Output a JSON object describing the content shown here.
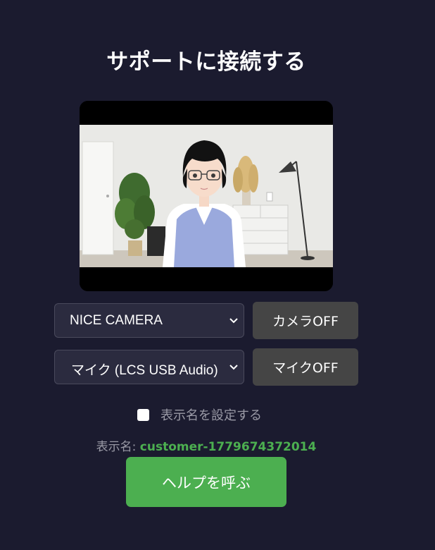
{
  "title": "サポートに接続する",
  "camera": {
    "selected": "NICE CAMERA",
    "toggle_label": "カメラOFF"
  },
  "mic": {
    "selected": "マイク (LCS USB Audio)",
    "toggle_label": "マイクOFF"
  },
  "set_display_name": {
    "label": "表示名を設定する",
    "checked": false
  },
  "display_name": {
    "label": "表示名: ",
    "value": "customer-1779674372014"
  },
  "help_button": "ヘルプを呼ぶ",
  "colors": {
    "background": "#1b1b2f",
    "accent_green": "#4caf50",
    "dark_button": "#454545"
  }
}
